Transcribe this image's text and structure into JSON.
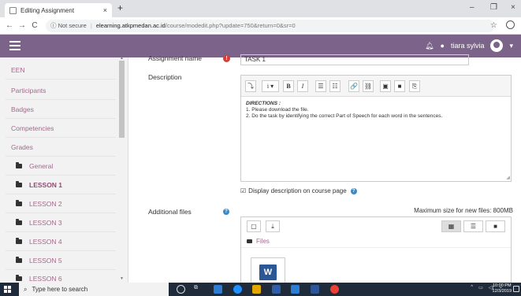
{
  "browser": {
    "tab_title": "Editing Assignment",
    "tab_close": "×",
    "new_tab": "+",
    "window_controls": {
      "minimize": "–",
      "restore": "❐",
      "close": "×"
    },
    "nav": {
      "back": "←",
      "forward": "→",
      "reload": "C"
    },
    "security_label": "ⓘ Not secure",
    "url_domain": "elearning.atkpmedan.ac.id",
    "url_path": "/course/modedit.php?update=750&return=0&sr=0"
  },
  "navbar": {
    "user_name": "tiara sylvia",
    "bg_color": "#7b6389"
  },
  "sidebar": {
    "items": [
      {
        "label": "EEN"
      },
      {
        "label": "Participants"
      },
      {
        "label": "Badges"
      },
      {
        "label": "Competencies"
      },
      {
        "label": "Grades"
      },
      {
        "label": "General"
      },
      {
        "label": "LESSON 1"
      },
      {
        "label": "LESSON 2"
      },
      {
        "label": "LESSON 3"
      },
      {
        "label": "LESSON 4"
      },
      {
        "label": "LESSON 5"
      },
      {
        "label": "LESSON 6"
      }
    ]
  },
  "form": {
    "assignment_name_label": "Assignment name",
    "assignment_name_value": "TASK 1",
    "description_label": "Description",
    "toolbar": {
      "collapse": "⤵",
      "info": "i ▾",
      "bold": "B",
      "italic": "I",
      "ul": "☰",
      "ol": "☷",
      "link": "🔗",
      "unlink": "⛓",
      "image": "▣",
      "media": "■",
      "manage": "⎘"
    },
    "description_lines": {
      "heading": "DIRECTIONS :",
      "line1": "1. Please download the file.",
      "line2": "2. Do the task by identifying the correct Part of Speech for each word in the sentences."
    },
    "display_on_course_page": "Display description on course page",
    "additional_files_label": "Additional files",
    "max_size": "Maximum size for new files: 800MB",
    "files_folder": "Files",
    "file_type_letter": "W"
  },
  "taskbar": {
    "search_placeholder": "Type here to search",
    "time": "10:00 PM",
    "date": "12/3/2019"
  }
}
